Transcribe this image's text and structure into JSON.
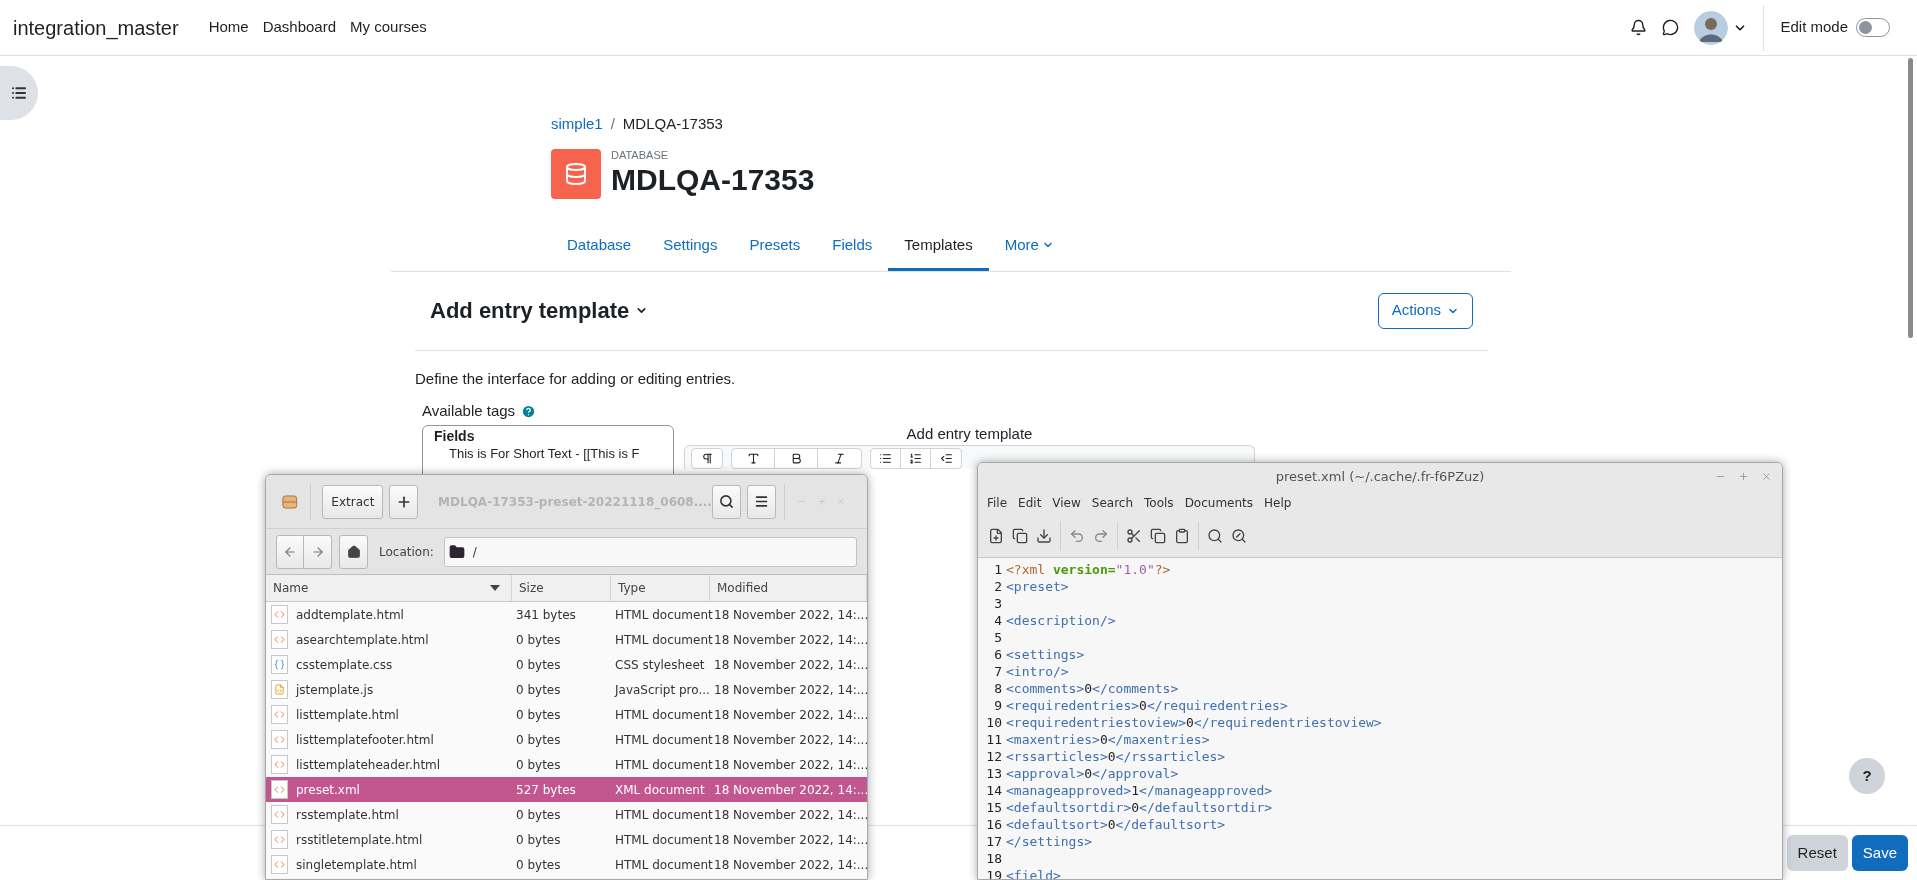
{
  "header": {
    "site_name": "integration_master",
    "nav": [
      "Home",
      "Dashboard",
      "My courses"
    ],
    "edit_mode": {
      "label": "Edit mode",
      "on": false
    }
  },
  "breadcrumb": [
    "simple1",
    "MDLQA-17353"
  ],
  "breadcrumb_separator": "/",
  "activity": {
    "type_label": "DATABASE",
    "title": "MDLQA-17353"
  },
  "tabs": [
    {
      "label": "Database",
      "selected": false,
      "kind": "link"
    },
    {
      "label": "Settings",
      "selected": false,
      "kind": "link"
    },
    {
      "label": "Presets",
      "selected": false,
      "kind": "link"
    },
    {
      "label": "Fields",
      "selected": false,
      "kind": "link"
    },
    {
      "label": "Templates",
      "selected": true,
      "kind": "link"
    },
    {
      "label": "More",
      "selected": false,
      "kind": "menu"
    }
  ],
  "template_heading": "Add entry template",
  "actions_button": "Actions",
  "description": "Define the interface for adding or editing entries.",
  "available_tags": {
    "label": "Available tags",
    "group": "Fields",
    "items": [
      "This is For Short Text - [[This is F"
    ]
  },
  "editor": {
    "label": "Add entry template"
  },
  "help_button": "?",
  "footer_buttons": [
    {
      "label": "Reset",
      "kind": "secondary"
    },
    {
      "label": "Save",
      "kind": "primary"
    }
  ],
  "archive_window": {
    "title": "MDLQA-17353-preset-20221118_0608....",
    "extract_button": "Extract",
    "location_label": "Location:",
    "location": "/",
    "columns": [
      "Name",
      "Size",
      "Type",
      "Modified"
    ],
    "rows": [
      {
        "name": "addtemplate.html",
        "size": "341 bytes",
        "type": "HTML document",
        "modified": "18 November 2022, 14:...",
        "kind": "markup",
        "selected": false
      },
      {
        "name": "asearchtemplate.html",
        "size": "0 bytes",
        "type": "HTML document",
        "modified": "18 November 2022, 14:...",
        "kind": "markup",
        "selected": false
      },
      {
        "name": "csstemplate.css",
        "size": "0 bytes",
        "type": "CSS stylesheet",
        "modified": "18 November 2022, 14:...",
        "kind": "style",
        "selected": false
      },
      {
        "name": "jstemplate.js",
        "size": "0 bytes",
        "type": "JavaScript pro...",
        "modified": "18 November 2022, 14:...",
        "kind": "script",
        "selected": false
      },
      {
        "name": "listtemplate.html",
        "size": "0 bytes",
        "type": "HTML document",
        "modified": "18 November 2022, 14:...",
        "kind": "markup",
        "selected": false
      },
      {
        "name": "listtemplatefooter.html",
        "size": "0 bytes",
        "type": "HTML document",
        "modified": "18 November 2022, 14:...",
        "kind": "markup",
        "selected": false
      },
      {
        "name": "listtemplateheader.html",
        "size": "0 bytes",
        "type": "HTML document",
        "modified": "18 November 2022, 14:...",
        "kind": "markup",
        "selected": false
      },
      {
        "name": "preset.xml",
        "size": "527 bytes",
        "type": "XML document",
        "modified": "18 November 2022, 14:...",
        "kind": "markup",
        "selected": true
      },
      {
        "name": "rsstemplate.html",
        "size": "0 bytes",
        "type": "HTML document",
        "modified": "18 November 2022, 14:...",
        "kind": "markup",
        "selected": false
      },
      {
        "name": "rsstitletemplate.html",
        "size": "0 bytes",
        "type": "HTML document",
        "modified": "18 November 2022, 14:...",
        "kind": "markup",
        "selected": false
      },
      {
        "name": "singletemplate.html",
        "size": "0 bytes",
        "type": "HTML document",
        "modified": "18 November 2022, 14:...",
        "kind": "markup",
        "selected": false
      }
    ]
  },
  "editor_window": {
    "title": "preset.xml (~/.cache/.fr-f6PZuz)",
    "menu": [
      "File",
      "Edit",
      "View",
      "Search",
      "Tools",
      "Documents",
      "Help"
    ],
    "lines": [
      {
        "number": "1",
        "segments": [
          {
            "text": "<?xml ",
            "kind": "pi"
          },
          {
            "text": "version=",
            "kind": "attr"
          },
          {
            "text": "\"1.0\"",
            "kind": "string"
          },
          {
            "text": "?>",
            "kind": "pi"
          }
        ]
      },
      {
        "number": "2",
        "segments": [
          {
            "text": "<preset>",
            "kind": "tag"
          }
        ]
      },
      {
        "number": "3"
      },
      {
        "number": "4",
        "segments": [
          {
            "text": "<description/>",
            "kind": "tag"
          }
        ]
      },
      {
        "number": "5"
      },
      {
        "number": "6",
        "segments": [
          {
            "text": "<settings>",
            "kind": "tag"
          }
        ]
      },
      {
        "number": "7",
        "segments": [
          {
            "text": "<intro/>",
            "kind": "tag"
          }
        ]
      },
      {
        "number": "8",
        "segments": [
          {
            "text": "<comments>",
            "kind": "tag"
          },
          {
            "text": "0",
            "kind": "text"
          },
          {
            "text": "</comments>",
            "kind": "tag"
          }
        ]
      },
      {
        "number": "9",
        "segments": [
          {
            "text": "<requiredentries>",
            "kind": "tag"
          },
          {
            "text": "0",
            "kind": "text"
          },
          {
            "text": "</requiredentries>",
            "kind": "tag"
          }
        ]
      },
      {
        "number": "10",
        "segments": [
          {
            "text": "<requiredentriestoview>",
            "kind": "tag"
          },
          {
            "text": "0",
            "kind": "text"
          },
          {
            "text": "</requiredentriestoview>",
            "kind": "tag"
          }
        ]
      },
      {
        "number": "11",
        "segments": [
          {
            "text": "<maxentries>",
            "kind": "tag"
          },
          {
            "text": "0",
            "kind": "text"
          },
          {
            "text": "</maxentries>",
            "kind": "tag"
          }
        ]
      },
      {
        "number": "12",
        "segments": [
          {
            "text": "<rssarticles>",
            "kind": "tag"
          },
          {
            "text": "0",
            "kind": "text"
          },
          {
            "text": "</rssarticles>",
            "kind": "tag"
          }
        ]
      },
      {
        "number": "13",
        "segments": [
          {
            "text": "<approval>",
            "kind": "tag"
          },
          {
            "text": "0",
            "kind": "text"
          },
          {
            "text": "</approval>",
            "kind": "tag"
          }
        ]
      },
      {
        "number": "14",
        "segments": [
          {
            "text": "<manageapproved>",
            "kind": "tag"
          },
          {
            "text": "1",
            "kind": "text"
          },
          {
            "text": "</manageapproved>",
            "kind": "tag"
          }
        ]
      },
      {
        "number": "15",
        "segments": [
          {
            "text": "<defaultsortdir>",
            "kind": "tag"
          },
          {
            "text": "0",
            "kind": "text"
          },
          {
            "text": "</defaultsortdir>",
            "kind": "tag"
          }
        ]
      },
      {
        "number": "16",
        "segments": [
          {
            "text": "<defaultsort>",
            "kind": "tag"
          },
          {
            "text": "0",
            "kind": "text"
          },
          {
            "text": "</defaultsort>",
            "kind": "tag"
          }
        ]
      },
      {
        "number": "17",
        "segments": [
          {
            "text": "</settings>",
            "kind": "tag"
          }
        ]
      },
      {
        "number": "18"
      },
      {
        "number": "19",
        "segments": [
          {
            "text": "<field>",
            "kind": "tag"
          }
        ]
      }
    ]
  }
}
